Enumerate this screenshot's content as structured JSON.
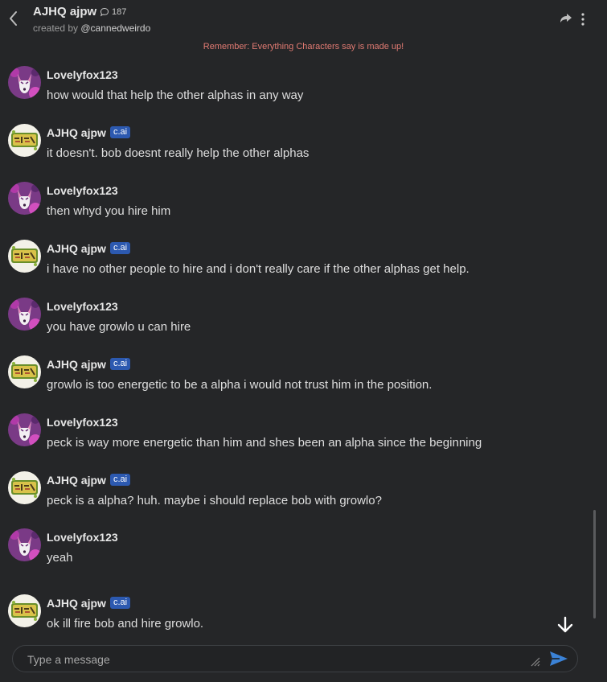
{
  "header": {
    "title": "AJHQ ajpw",
    "chat_count": "187",
    "created_by_prefix": "created by ",
    "created_by_user": "@cannedweirdo"
  },
  "notice": "Remember: Everything Characters say is made up!",
  "badge_label": "c.ai",
  "messages": [
    {
      "author": "Lovelyfox123",
      "text": "how would that help the other alphas in any way"
    },
    {
      "author": "AJHQ ajpw",
      "text": "it doesn't. bob doesnt really help the other alphas"
    },
    {
      "author": "Lovelyfox123",
      "text": "then whyd you hire him"
    },
    {
      "author": "AJHQ ajpw",
      "text": "i have no other people to hire and i don't really care if the other alphas get help."
    },
    {
      "author": "Lovelyfox123",
      "text": "you have growlo u can hire"
    },
    {
      "author": "AJHQ ajpw",
      "text": "growlo is too energetic to be a alpha i would not trust him in the position."
    },
    {
      "author": "Lovelyfox123",
      "text": "peck is way more energetic than him and shes been an alpha since the beginning"
    },
    {
      "author": "AJHQ ajpw",
      "text": "peck is a alpha? huh. maybe i should replace bob with growlo?"
    },
    {
      "author": "Lovelyfox123",
      "text": "yeah"
    },
    {
      "author": "AJHQ ajpw",
      "text": "ok ill fire bob and hire growlo."
    }
  ],
  "composer": {
    "placeholder": "Type a message",
    "value": ""
  },
  "colors": {
    "background": "#252628",
    "badge": "#2c59b0",
    "notice": "#e07a72",
    "send": "#3b82d6"
  },
  "icons": [
    "back-icon",
    "chat-bubble-icon",
    "share-icon",
    "more-icon",
    "scroll-down-icon",
    "resize-icon",
    "send-icon"
  ]
}
